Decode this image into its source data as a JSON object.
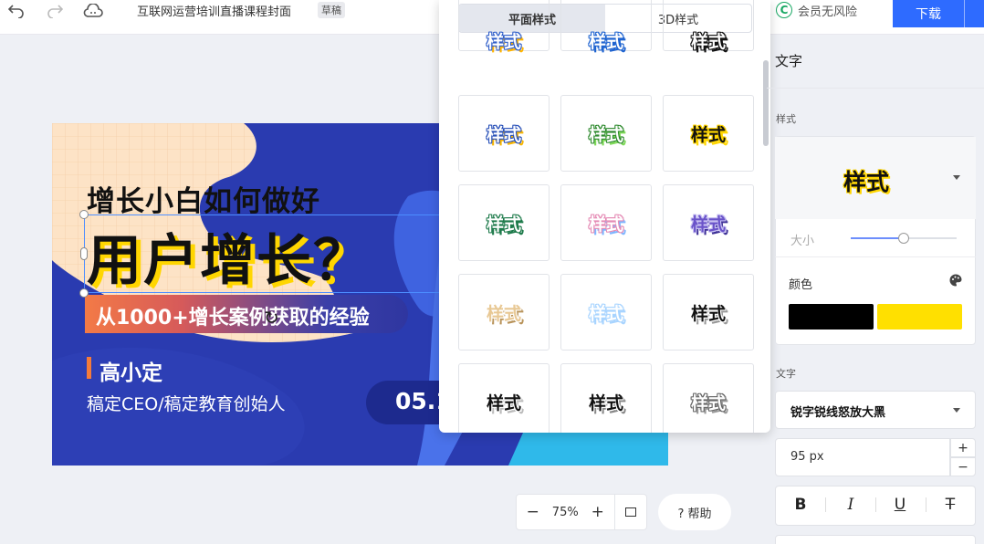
{
  "topbar": {
    "undo_icon": "undo-icon",
    "redo_icon": "redo-icon",
    "cloud_icon": "cloud-icon",
    "title": "互联网运营培训直播课程封面",
    "draft_badge": "草稿"
  },
  "header_right": {
    "vip_badge_letter": "C",
    "vip_text": "会员无风险",
    "download_label": "下载"
  },
  "canvas": {
    "line1": "增长小白如何做好",
    "line2": "用户增长？",
    "line3": "从1000+增长案例获取的经验",
    "speaker": "高小定",
    "speaker_title": "稿定CEO/稿定教育创始人",
    "date": "05.1",
    "colors": {
      "bg": "#2a3bb0",
      "cream": "#fde3c6",
      "blue_blob": "#3550d8",
      "accent": "#ffd600",
      "orange": "#f37a46"
    }
  },
  "popup": {
    "tabs": [
      "平面样式",
      "3D样式"
    ],
    "active_tab": "平面样式",
    "sample_text": "样式",
    "styles": [
      {
        "fill": "#ffffff",
        "stroke": "#2f5ec9",
        "shadow": "#ffb400",
        "partial": true
      },
      {
        "fill": "#ffffff",
        "stroke": "#1e63d0",
        "shadow": "#1e63d0",
        "partial": true
      },
      {
        "fill": "#ffffff",
        "stroke": "#111111",
        "shadow": "#111111",
        "partial": true
      },
      {
        "fill": "#ffffff",
        "stroke": "#274fb8",
        "shadow": "#f7b500"
      },
      {
        "fill": "#ffffff",
        "stroke": "#2e8a2e",
        "shadow": "#7ed957"
      },
      {
        "fill": "#111111",
        "stroke": "#ffd600",
        "shadow": "#ffd600"
      },
      {
        "fill": "#ffffff",
        "stroke": "#1d7a4a",
        "shadow": "#1d7a4a"
      },
      {
        "fill": "#ffffff",
        "stroke": "#e58bb5",
        "shadow": "#7fb6ff"
      },
      {
        "fill": "#6a53c9",
        "stroke": "#c9c2f2",
        "shadow": "#3d2f96"
      },
      {
        "fill": "#e8c894",
        "stroke": "#ffffff",
        "shadow": "#b8935a"
      },
      {
        "fill": "#ffffff",
        "stroke": "#a8d4ff",
        "shadow": "#a8d4ff"
      },
      {
        "fill": "#111111",
        "stroke": "#ffffff",
        "shadow": "#999999"
      },
      {
        "fill": "#111111",
        "stroke": "#ffffff",
        "shadow": "#bbbbbb"
      },
      {
        "fill": "#111111",
        "stroke": "#ffffff",
        "shadow": "#888888"
      },
      {
        "fill": "#ffffff",
        "stroke": "#666666",
        "shadow": "#999999"
      }
    ]
  },
  "panel": {
    "heading": "文字",
    "style_section": "样式",
    "preview_text": "样式",
    "size_label": "大小",
    "size_slider_fraction": 0.5,
    "color_label": "颜色",
    "palette_icon": "palette-icon",
    "colors": [
      "#000000",
      "#ffe000"
    ],
    "font_section": "文字",
    "font_name": "锐字锐线怒放大黑",
    "font_size": "95 px",
    "plus": "+",
    "minus": "−",
    "format_buttons": [
      {
        "name": "bold-button",
        "label": "B"
      },
      {
        "name": "italic-button",
        "label": "I"
      },
      {
        "name": "underline-button",
        "label": "U"
      },
      {
        "name": "strikethrough-button",
        "label": "T"
      }
    ]
  },
  "zoom": {
    "minus": "−",
    "value": "75%",
    "plus": "+",
    "fit_icon": "fit-screen-icon"
  },
  "help": {
    "label": "? 帮助"
  }
}
